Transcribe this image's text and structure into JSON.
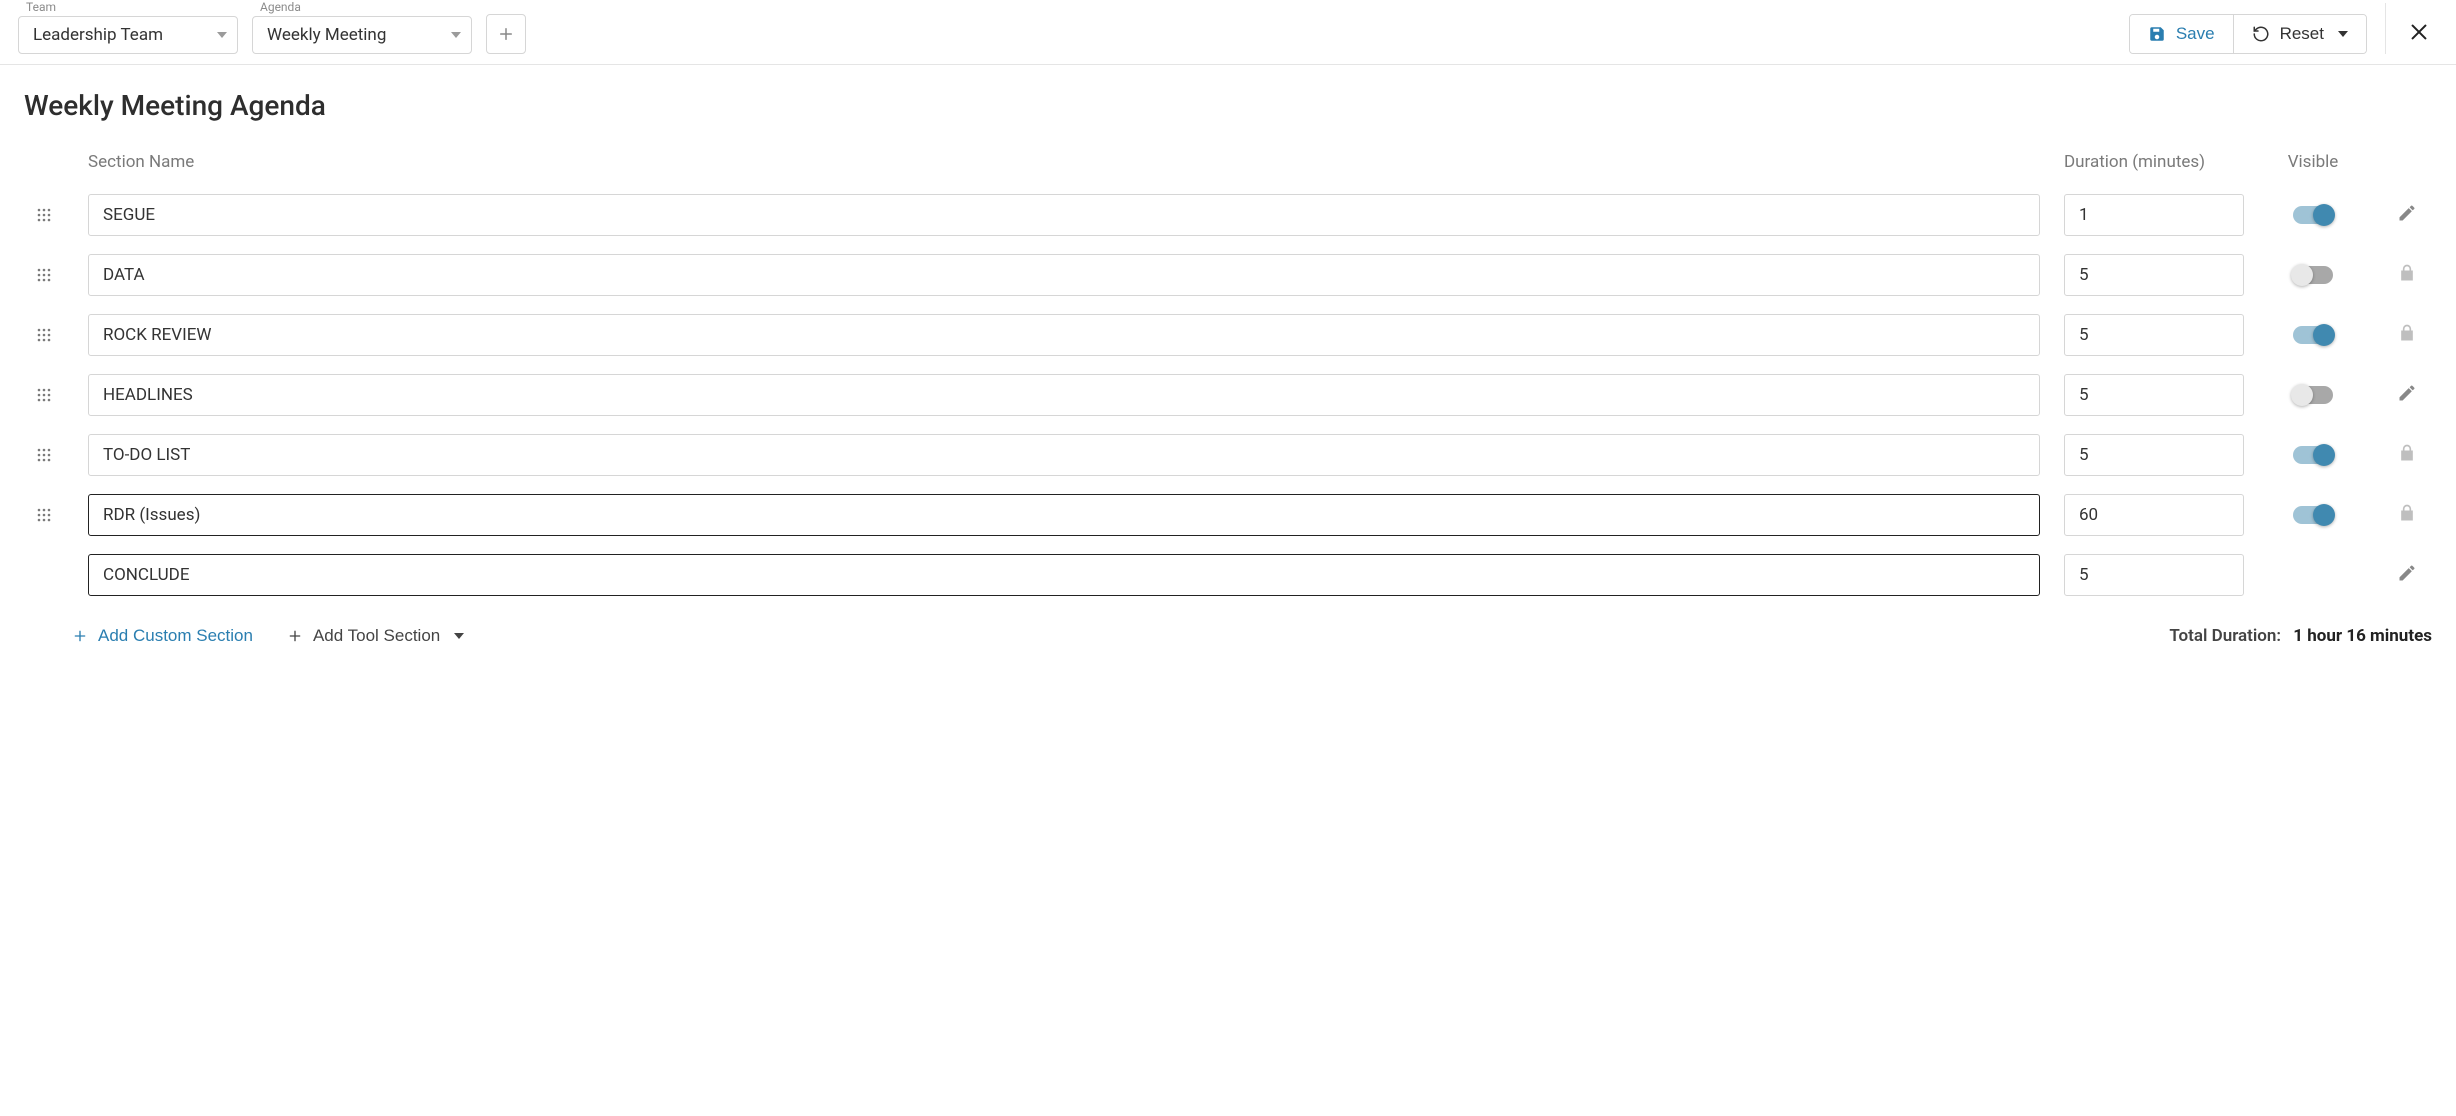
{
  "header": {
    "team_label": "Team",
    "team_value": "Leadership Team",
    "agenda_label": "Agenda",
    "agenda_value": "Weekly Meeting",
    "save_label": "Save",
    "reset_label": "Reset"
  },
  "page": {
    "title": "Weekly Meeting Agenda",
    "column_headers": {
      "section_name": "Section Name",
      "duration": "Duration (minutes)",
      "visible": "Visible"
    },
    "sections": [
      {
        "name": "SEGUE",
        "duration": "1",
        "visible": true,
        "action": "edit",
        "has_handle": true,
        "strong_border": false
      },
      {
        "name": "DATA",
        "duration": "5",
        "visible": false,
        "action": "locked",
        "has_handle": true,
        "strong_border": false
      },
      {
        "name": "ROCK REVIEW",
        "duration": "5",
        "visible": true,
        "action": "locked",
        "has_handle": true,
        "strong_border": false
      },
      {
        "name": "HEADLINES",
        "duration": "5",
        "visible": false,
        "action": "edit",
        "has_handle": true,
        "strong_border": false
      },
      {
        "name": "TO-DO LIST",
        "duration": "5",
        "visible": true,
        "action": "locked",
        "has_handle": true,
        "strong_border": false
      },
      {
        "name": "RDR (Issues)",
        "duration": "60",
        "visible": true,
        "action": "locked",
        "has_handle": true,
        "strong_border": true
      },
      {
        "name": "CONCLUDE",
        "duration": "5",
        "visible": null,
        "action": "edit",
        "has_handle": false,
        "strong_border": true
      }
    ],
    "footer": {
      "add_custom_label": "Add Custom Section",
      "add_tool_label": "Add Tool Section",
      "total_label": "Total Duration:",
      "total_value": "1 hour  16 minutes"
    }
  }
}
